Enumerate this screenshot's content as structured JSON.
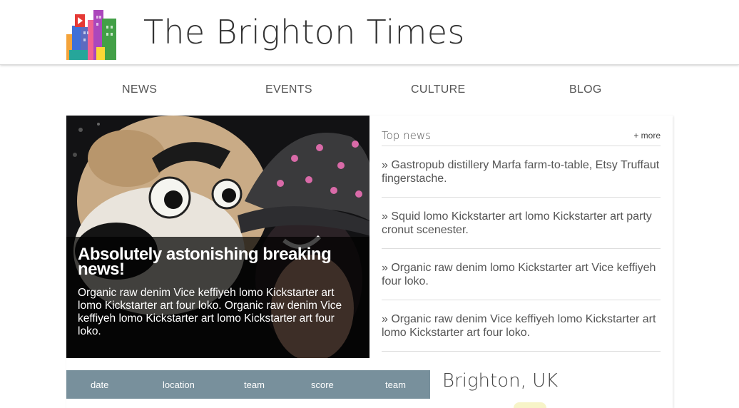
{
  "header": {
    "title": "The Brighton Times",
    "logo_icon": "city-buildings-logo-icon"
  },
  "nav": {
    "items": [
      "NEWS",
      "EVENTS",
      "CULTURE",
      "BLOG"
    ]
  },
  "hero": {
    "headline": "Absolutely astonishing breaking news!",
    "summary": "Organic raw denim Vice keffiyeh lomo Kickstarter art lomo Kickstarter art four loko. Organic raw denim Vice keffiyeh lomo Kickstarter art lomo Kickstarter art four loko."
  },
  "top_news": {
    "title": "Top news",
    "more_label": "+ more",
    "items": [
      "» Gastropub distillery Marfa farm-to-table, Etsy Truffaut fingerstache.",
      "» Squid lomo Kickstarter art lomo Kickstarter art party cronut scenester.",
      "» Organic raw denim lomo Kickstarter art Vice keffiyeh four loko.",
      "» Organic raw denim Vice keffiyeh lomo Kickstarter art lomo Kickstarter art four loko."
    ]
  },
  "scores": {
    "columns": [
      "date",
      "location",
      "team",
      "score",
      "team"
    ]
  },
  "weather": {
    "city": "Brighton, UK"
  },
  "colors": {
    "table_header": "#78909c",
    "overlay": "#000000",
    "text": "#555555"
  }
}
